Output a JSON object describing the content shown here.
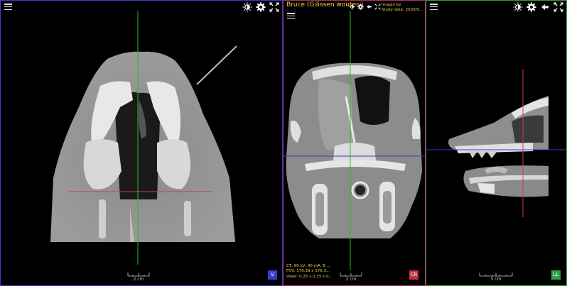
{
  "viewports": {
    "axial": {
      "scale_label": "2 cm",
      "orientation_label": "V",
      "colors": {
        "border": "#3a3ad0",
        "badge": "#3a3ad0",
        "crosshair_v": "#22c022",
        "crosshair_h": "#d03a50"
      }
    },
    "coronal": {
      "patient_name": "Bruce (Gilissen wouter )",
      "study_line1": "Imagin bv",
      "study_line2": "Study date: 2020/0...",
      "meta_line1": "CT, 90 kV, 40 mA, 8 ...",
      "meta_line2": "FOV: 176.39 x 176.3...",
      "meta_line3": "Voxel: 0.25 x 0.25 x 0...",
      "scale_label": "2 cm",
      "orientation_label": "CR",
      "colors": {
        "border": "#b03060",
        "badge": "#c03040",
        "crosshair_v": "#22c022",
        "crosshair_h": "#3a3ad0"
      }
    },
    "sagittal": {
      "scale_label": "5 cm",
      "orientation_label": "LL",
      "colors": {
        "border": "#2ea043",
        "badge": "#2ea043",
        "crosshair_v": "#d03a50",
        "crosshair_h": "#3a3ad0"
      }
    }
  },
  "icons": {
    "menu": "menu-icon",
    "brightness": "brightness-contrast-icon",
    "settings": "gear-icon",
    "fullscreen": "fullscreen-icon",
    "back": "arrow-left-icon"
  }
}
